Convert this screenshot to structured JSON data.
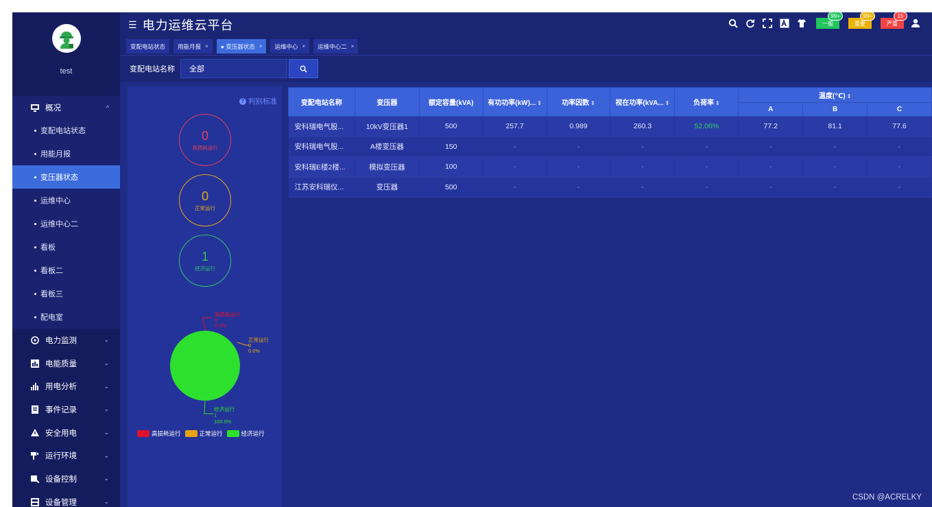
{
  "user": {
    "name": "test"
  },
  "menu": {
    "overview": {
      "label": "概况",
      "arrow": "^"
    },
    "overview_items": [
      {
        "label": "变配电站状态",
        "active": false
      },
      {
        "label": "用能月报",
        "active": false
      },
      {
        "label": "变压器状态",
        "active": true
      },
      {
        "label": "运维中心",
        "active": false
      },
      {
        "label": "运维中心二",
        "active": false
      },
      {
        "label": "看板",
        "active": false
      },
      {
        "label": "看板二",
        "active": false
      },
      {
        "label": "看板三",
        "active": false
      },
      {
        "label": "配电室",
        "active": false
      }
    ],
    "groups": [
      {
        "label": "电力监测",
        "icon": "monitor-icon"
      },
      {
        "label": "电能质量",
        "icon": "quality-icon"
      },
      {
        "label": "用电分析",
        "icon": "analysis-icon"
      },
      {
        "label": "事件记录",
        "icon": "event-icon"
      },
      {
        "label": "安全用电",
        "icon": "safety-icon"
      },
      {
        "label": "运行环境",
        "icon": "environment-icon"
      },
      {
        "label": "设备控制",
        "icon": "control-icon"
      },
      {
        "label": "设备管理",
        "icon": "device-icon"
      }
    ]
  },
  "header": {
    "title": "电力运维云平台",
    "alerts": [
      {
        "label": "一般",
        "count": "99+",
        "color": "#22c55e"
      },
      {
        "label": "重要",
        "count": "99+",
        "color": "#eab308"
      },
      {
        "label": "严重",
        "count": "15",
        "color": "#ef4444"
      }
    ]
  },
  "tabs": [
    {
      "label": "变配电站状态",
      "closable": false,
      "active": false
    },
    {
      "label": "用能月报",
      "closable": true,
      "active": false
    },
    {
      "label": "● 变压器状态",
      "closable": true,
      "active": true
    },
    {
      "label": "运维中心",
      "closable": true,
      "active": false
    },
    {
      "label": "运维中心二",
      "closable": true,
      "active": false
    }
  ],
  "filter": {
    "label": "变配电站名称",
    "value": "全部"
  },
  "status_panel": {
    "criteria_label": "判别标准",
    "circles": [
      {
        "value": "0",
        "label": "高损耗运行",
        "color": "#e0405a"
      },
      {
        "value": "0",
        "label": "正常运行",
        "color": "#e7a91a"
      },
      {
        "value": "1",
        "label": "经济运行",
        "color": "#2fc66a"
      }
    ],
    "pie": {
      "slices": [
        {
          "name": "高损耗运行",
          "value": 0,
          "percent": "0.0%",
          "color": "#e0102f"
        },
        {
          "name": "正常运行",
          "value": 0,
          "percent": "0.0%",
          "color": "#e8a50f"
        },
        {
          "name": "经济运行",
          "value": 1,
          "percent": "100.0%",
          "color": "#2ee02e"
        }
      ]
    }
  },
  "table": {
    "headers": [
      "变配电站名称",
      "变压器",
      "额定容量(kVA)",
      "有功功率(kW)...",
      "功率因数",
      "视在功率(kVA...",
      "负荷率",
      "温度(℃)"
    ],
    "temp_sub": [
      "A",
      "B",
      "C"
    ],
    "rows": [
      [
        "安科瑞电气股...",
        "10kV变压器1",
        "500",
        "257.7",
        "0.989",
        "260.3",
        "52.06%",
        "77.2",
        "81.1",
        "77.6"
      ],
      [
        "安科瑞电气股...",
        "A楼变压器",
        "150",
        "-",
        "-",
        "-",
        "-",
        "-",
        "-",
        "-"
      ],
      [
        "安科瑞E楼2楼...",
        "模拟变压器",
        "100",
        "-",
        "-",
        "-",
        "-",
        "-",
        "-",
        "-"
      ],
      [
        "江苏安科瑞仪...",
        "变压器",
        "500",
        "-",
        "-",
        "-",
        "-",
        "-",
        "-",
        "-"
      ]
    ]
  },
  "watermark": "CSDN @ACRELKY"
}
